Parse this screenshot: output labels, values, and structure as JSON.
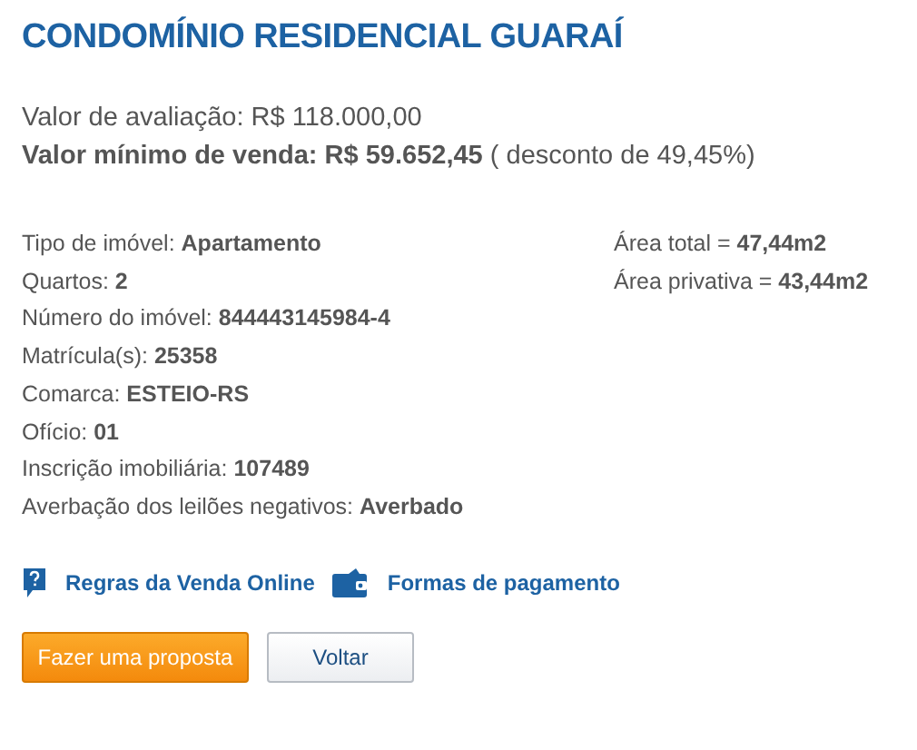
{
  "title": "CONDOMÍNIO RESIDENCIAL GUARAÍ",
  "valuation": "Valor de avaliação: R$ 118.000,00",
  "minimum_sale": "**Valor mínimo de venda: R$ 59.652,45** ( desconto de 49,45%)",
  "details": [
    "Tipo de imóvel: **Apartamento**",
    "Quartos: **2**",
    "Número do imóvel: **844443145984-4**",
    "Matrícula(s): **25358**",
    "Comarca: **ESTEIO-RS**",
    "Ofício: **01**",
    "Inscrição imobiliária: **107489**",
    "Averbação dos leilões negativos: **Averbado**"
  ],
  "areas": [
    "Área total = **47,44m2**",
    "Área privativa = **43,44m2**"
  ],
  "links": [
    {
      "kind": "help",
      "label": "Regras da Venda Online"
    },
    {
      "kind": "wallet",
      "label": "Formas de pagamento"
    }
  ],
  "buttons": [
    {
      "kind": "primary",
      "label": "Fazer uma proposta"
    },
    {
      "kind": "secondary",
      "label": "Voltar"
    }
  ]
}
